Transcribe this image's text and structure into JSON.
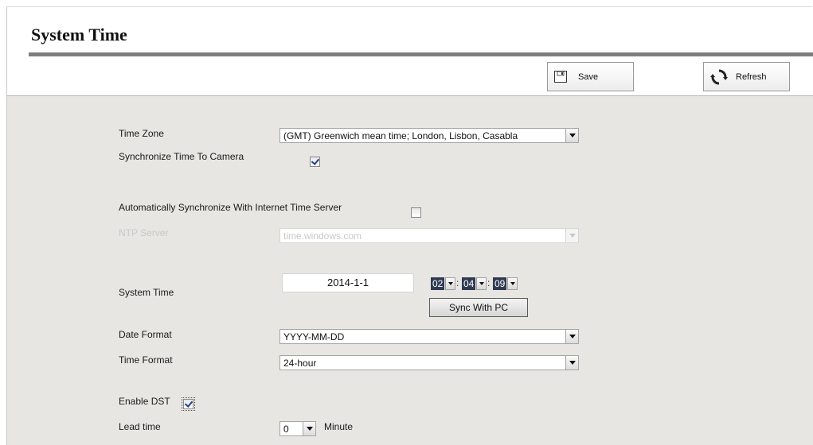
{
  "header": {
    "title": "System Time",
    "save_label": "Save",
    "refresh_label": "Refresh"
  },
  "form": {
    "time_zone": {
      "label": "Time Zone",
      "value": "(GMT) Greenwich mean time; London, Lisbon, Casabla"
    },
    "sync_camera": {
      "label": "Synchronize Time To Camera",
      "checked": true
    },
    "auto_sync": {
      "label": "Automatically Synchronize With Internet Time Server",
      "checked": false
    },
    "ntp_server": {
      "label": "NTP Server",
      "value": "time.windows.com",
      "disabled": true
    },
    "system_time": {
      "label": "System Time",
      "date": "2014-1-1",
      "hour": "02",
      "minute": "04",
      "second": "09",
      "separator": ":",
      "sync_button": "Sync With PC"
    },
    "date_format": {
      "label": "Date Format",
      "value": "YYYY-MM-DD"
    },
    "time_format": {
      "label": "Time Format",
      "value": "24-hour"
    },
    "dst": {
      "label": "Enable DST",
      "checked": true
    },
    "lead_time": {
      "label": "Lead time",
      "value": "0",
      "unit": "Minute"
    }
  },
  "icons": {
    "save": "floppy-disk-icon",
    "refresh": "refresh-icon"
  }
}
